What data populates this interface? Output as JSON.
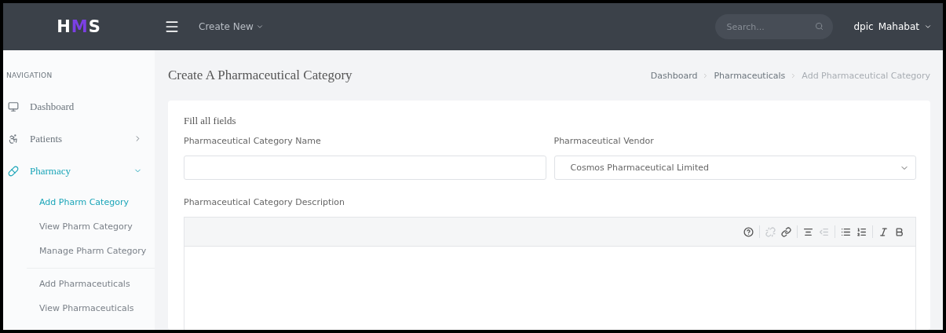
{
  "topbar": {
    "logo": [
      {
        "text": "H",
        "accent": false
      },
      {
        "text": "M",
        "accent": true
      },
      {
        "text": "S",
        "accent": false
      }
    ],
    "create_menu": "Create New",
    "search": {
      "placeholder": "Search..."
    },
    "user": {
      "avatar_alt": "dpic",
      "name": "Mahabat"
    }
  },
  "sidebar": {
    "heading": "NAVIGATION",
    "items": [
      {
        "kind": "dashboard",
        "label": "Dashboard",
        "selected": false
      },
      {
        "kind": "patients",
        "label": "Patients",
        "selected": false,
        "expanded": false
      },
      {
        "kind": "pharmacy",
        "label": "Pharmacy",
        "selected": true,
        "expanded": true,
        "children": [
          [
            {
              "label": "Add Pharm Category",
              "selected": true
            },
            {
              "label": "View Pharm Category",
              "selected": false
            },
            {
              "label": "Manage Pharm Category",
              "selected": false
            }
          ],
          [
            {
              "label": "Add Pharmaceuticals",
              "selected": false
            },
            {
              "label": "View Pharmaceuticals",
              "selected": false
            }
          ]
        ]
      }
    ]
  },
  "page": {
    "title": "Create A Pharmaceutical Category",
    "breadcrumbs": [
      {
        "label": "Dashboard",
        "selected": false
      },
      {
        "label": "Pharmaceuticals",
        "selected": false
      },
      {
        "label": "Add Pharmaceutical Category",
        "selected": true
      }
    ]
  },
  "form": {
    "intro": "Fill all fields",
    "name_label": "Pharmaceutical Category Name",
    "vendor_label": "Pharmaceutical Vendor",
    "vendor_value": "Cosmos Pharmaceutical Limited",
    "description_label": "Pharmaceutical Category Description",
    "toolbar": [
      {
        "kind": "help",
        "disabled": false
      },
      {
        "kind": "unlink",
        "disabled": true
      },
      {
        "kind": "link",
        "disabled": false
      },
      {
        "kind": "indent",
        "disabled": false
      },
      {
        "kind": "outdent",
        "disabled": true
      },
      {
        "kind": "bullets",
        "disabled": false
      },
      {
        "kind": "numbers",
        "disabled": false
      },
      {
        "kind": "italic",
        "disabled": false
      },
      {
        "kind": "bold",
        "disabled": false
      }
    ]
  }
}
